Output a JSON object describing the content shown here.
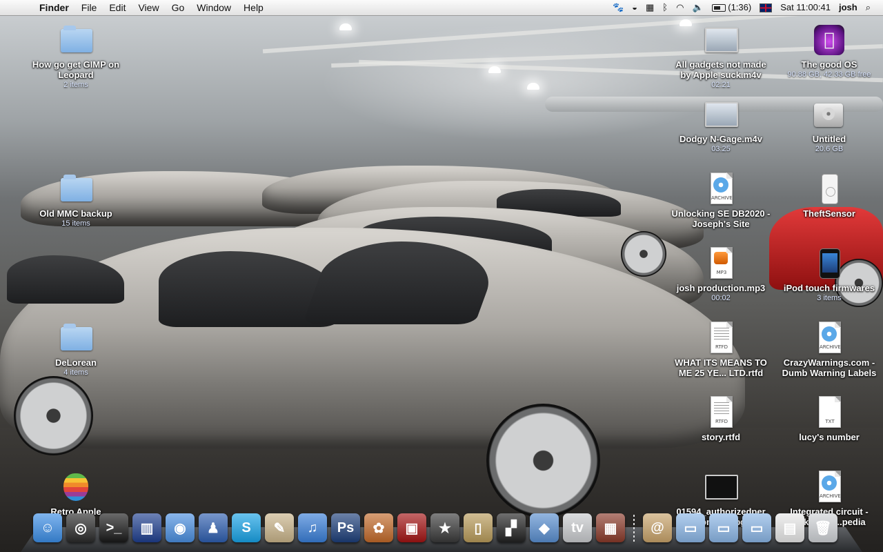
{
  "menubar": {
    "apple_glyph": "",
    "app_name": "Finder",
    "menus": [
      "File",
      "Edit",
      "View",
      "Go",
      "Window",
      "Help"
    ],
    "battery_time": "(1:36)",
    "clock": "Sat 11:00:41",
    "user": "josh",
    "status_icons": [
      "paw-icon",
      "disc-icon",
      "spaces-icon",
      "bluetooth-icon",
      "wifi-icon",
      "volume-icon",
      "battery-icon",
      "uk-flag-icon",
      "spotlight-icon"
    ]
  },
  "desktop_left": [
    {
      "name": "How go get GIMP on Leopard",
      "sub": "2 items",
      "icon": "folder-icon"
    },
    {
      "name": "Old MMC backup",
      "sub": "15 items",
      "icon": "folder-icon"
    },
    {
      "name": "DeLorean",
      "sub": "4 items",
      "icon": "folder-icon"
    },
    {
      "name": "Retro Apple",
      "sub": "",
      "icon": "rainbow-apple-icon"
    }
  ],
  "desktop_col1": [
    {
      "name": "All gadgets not made by Apple suck.m4v",
      "sub": "02:21",
      "icon": "movie-icon"
    },
    {
      "name": "Dodgy N-Gage.m4v",
      "sub": "03:25",
      "icon": "movie-icon"
    },
    {
      "name": "Unlocking SE DB2020 - Joseph's Site",
      "sub": "",
      "icon": "webarchive-icon",
      "tag": "ARCHIVE"
    },
    {
      "name": "josh production.mp3",
      "sub": "00:02",
      "icon": "mp3-icon",
      "tag": "MP3"
    },
    {
      "name": "WHAT ITS MEANS TO ME 25 YE... LTD.rtfd",
      "sub": "",
      "icon": "rtfd-icon",
      "tag": "RTFD"
    },
    {
      "name": "story.rtfd",
      "sub": "",
      "icon": "rtfd-icon",
      "tag": "RTFD"
    },
    {
      "name": "01594_authorizedper sonnel...jpg",
      "sub": "",
      "icon": "image-icon"
    }
  ],
  "desktop_col2": [
    {
      "name": "The good OS",
      "sub": "90.88 GB, 42.33 GB free",
      "icon": "apple-drive-icon"
    },
    {
      "name": "Untitled",
      "sub": "20.6 GB",
      "icon": "hard-drive-icon"
    },
    {
      "name": "TheftSensor",
      "sub": "",
      "icon": "ipod-icon"
    },
    {
      "name": "iPod touch firmwares",
      "sub": "3 items",
      "icon": "ipod-touch-icon"
    },
    {
      "name": "CrazyWarnings.com - Dumb Warning Labels",
      "sub": "",
      "icon": "webarchive-icon",
      "tag": "ARCHIVE"
    },
    {
      "name": "lucy's number",
      "sub": "",
      "icon": "txt-icon",
      "tag": "TXT"
    },
    {
      "name": "Integrated circuit - Wikipedia...pedia",
      "sub": "",
      "icon": "webarchive-icon",
      "tag": "ARCHIVE"
    }
  ],
  "dock": [
    {
      "name": "finder-icon",
      "color": "#3c8ee6",
      "glyph": "☺"
    },
    {
      "name": "dashboard-icon",
      "color": "#2b2b2b",
      "glyph": "◎"
    },
    {
      "name": "terminal-icon",
      "color": "#1a1a1a",
      "glyph": ">_"
    },
    {
      "name": "tardis-icon",
      "color": "#1f3f8f",
      "glyph": "▥"
    },
    {
      "name": "ichat-icon",
      "color": "#4b8fe0",
      "glyph": "◉"
    },
    {
      "name": "adium-icon",
      "color": "#2f5fb0",
      "glyph": "♟"
    },
    {
      "name": "skype-icon",
      "color": "#19a3e6",
      "glyph": "S"
    },
    {
      "name": "preview-icon",
      "color": "#c9b48a",
      "glyph": "✎"
    },
    {
      "name": "itunes-icon",
      "color": "#3a7fd8",
      "glyph": "♫"
    },
    {
      "name": "photoshop-icon",
      "color": "#1d3f7a",
      "glyph": "Ps"
    },
    {
      "name": "iphoto-icon",
      "color": "#c26a2a",
      "glyph": "✿"
    },
    {
      "name": "photo-booth-icon",
      "color": "#a31414",
      "glyph": "▣"
    },
    {
      "name": "imovie-icon",
      "color": "#3a3a3a",
      "glyph": "★"
    },
    {
      "name": "gadget-icon",
      "color": "#b89b5a",
      "glyph": "▯"
    },
    {
      "name": "clapper-icon",
      "color": "#222222",
      "glyph": "▞"
    },
    {
      "name": "front-row-icon",
      "color": "#5a8fd0",
      "glyph": "◆"
    },
    {
      "name": "apple-tv-icon",
      "color": "#c9cbce",
      "glyph": "tv"
    },
    {
      "name": "cinema-icon",
      "color": "#8a3a2a",
      "glyph": "▦"
    }
  ],
  "dock_right": [
    {
      "name": "address-book-stack-icon",
      "color": "#c8a36a",
      "glyph": "@"
    },
    {
      "name": "applications-folder-icon",
      "color": "#8bb6e6",
      "glyph": "▭"
    },
    {
      "name": "documents-folder-icon",
      "color": "#8bb6e6",
      "glyph": "▭"
    },
    {
      "name": "downloads-folder-icon",
      "color": "#8bb6e6",
      "glyph": "▭"
    },
    {
      "name": "document-stack-icon",
      "color": "#e8e8e8",
      "glyph": "▤"
    },
    {
      "name": "trash-icon",
      "color": "#cfd2d6",
      "glyph": "🗑"
    }
  ]
}
